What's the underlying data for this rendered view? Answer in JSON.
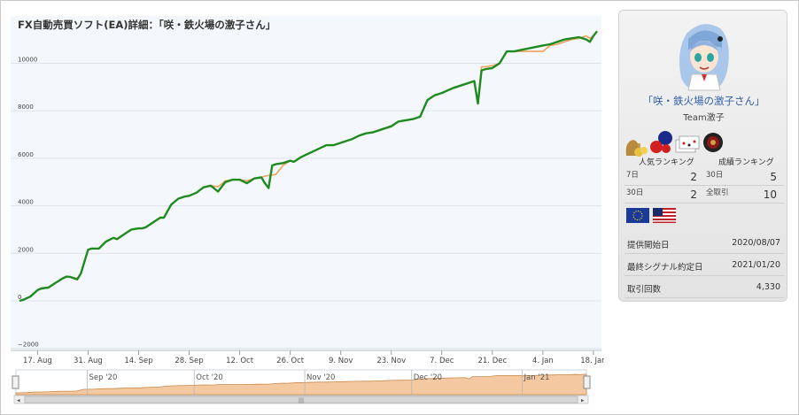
{
  "chart_data": {
    "type": "line",
    "title": "FX自動売買ソフト(EA)詳細：「咲・鉄火場の激子さん」",
    "xlabel": "",
    "ylabel": "",
    "ylim": [
      -2000,
      11800
    ],
    "yticks": [
      -2000,
      0,
      2000,
      4000,
      6000,
      8000,
      10000
    ],
    "ytick_labels": [
      "−2000",
      "0",
      "2000",
      "4000",
      "6000",
      "8000",
      "10000"
    ],
    "x_start": "2020-08-12",
    "x_end": "2021-01-19",
    "xticks": [
      "2020-08-17",
      "2020-08-31",
      "2020-09-14",
      "2020-09-28",
      "2020-10-12",
      "2020-10-26",
      "2020-11-09",
      "2020-11-23",
      "2020-12-07",
      "2020-12-21",
      "2021-01-04",
      "2021-01-18"
    ],
    "xtick_labels": [
      "17. Aug",
      "31. Aug",
      "14. Sep",
      "28. Sep",
      "12. Oct",
      "26. Oct",
      "9. Nov",
      "23. Nov",
      "7. Dec",
      "21. Dec",
      "4. Jan",
      "18. Jan"
    ],
    "grid": true,
    "series": [
      {
        "color": "#f0a060",
        "x": [
          "2020-08-12",
          "2020-08-13",
          "2020-08-15",
          "2020-08-17",
          "2020-08-18",
          "2020-08-20",
          "2020-08-22",
          "2020-08-24",
          "2020-08-25",
          "2020-08-26",
          "2020-08-28",
          "2020-08-29",
          "2020-08-31",
          "2020-09-01",
          "2020-09-03",
          "2020-09-05",
          "2020-09-07",
          "2020-09-08",
          "2020-09-10",
          "2020-09-12",
          "2020-09-14",
          "2020-09-15",
          "2020-09-16",
          "2020-09-18",
          "2020-09-20",
          "2020-09-21",
          "2020-09-23",
          "2020-09-25",
          "2020-09-27",
          "2020-09-28",
          "2020-09-30",
          "2020-10-02",
          "2020-10-04",
          "2020-10-06",
          "2020-10-08",
          "2020-10-10",
          "2020-10-12",
          "2020-10-14",
          "2020-10-16",
          "2020-10-18",
          "2020-10-19",
          "2020-10-21",
          "2020-10-22",
          "2020-10-24",
          "2020-10-26",
          "2020-10-27",
          "2020-10-29",
          "2020-11-05",
          "2020-11-07",
          "2020-11-09",
          "2020-11-12",
          "2020-11-14",
          "2020-11-16",
          "2020-11-18",
          "2020-11-20",
          "2020-11-23",
          "2020-11-25",
          "2020-11-27",
          "2020-11-29",
          "2020-12-01",
          "2020-12-03",
          "2020-12-05",
          "2020-12-07",
          "2020-12-10",
          "2020-12-14",
          "2020-12-16",
          "2020-12-17",
          "2020-12-18",
          "2020-12-19",
          "2020-12-21",
          "2020-12-23",
          "2020-12-25",
          "2020-12-27",
          "2021-01-04",
          "2021-01-06",
          "2021-01-08",
          "2021-01-10",
          "2021-01-12",
          "2021-01-14",
          "2021-01-16",
          "2021-01-17",
          "2021-01-18",
          "2021-01-19"
        ],
        "y": [
          0,
          40,
          180,
          450,
          520,
          560,
          760,
          950,
          1020,
          1010,
          950,
          1150,
          2150,
          2200,
          2200,
          2500,
          2650,
          2580,
          2800,
          3000,
          3050,
          3050,
          3100,
          3300,
          3500,
          3500,
          4050,
          4300,
          4400,
          4420,
          4550,
          4780,
          4850,
          4800,
          5050,
          5100,
          5100,
          5050,
          5150,
          5200,
          5250,
          5300,
          5320,
          5700,
          5900,
          5850,
          6050,
          6550,
          6550,
          6650,
          6800,
          6950,
          7050,
          7100,
          7200,
          7350,
          7550,
          7600,
          7650,
          7750,
          8450,
          8650,
          8750,
          8950,
          9150,
          9250,
          8400,
          9850,
          9850,
          9900,
          10000,
          10500,
          10500,
          10500,
          10750,
          10800,
          10900,
          11000,
          11050,
          11150,
          11050,
          11150,
          11350
        ]
      },
      {
        "color": "#1f8a1f",
        "x": [
          "2020-08-12",
          "2020-08-13",
          "2020-08-15",
          "2020-08-17",
          "2020-08-18",
          "2020-08-20",
          "2020-08-22",
          "2020-08-24",
          "2020-08-25",
          "2020-08-26",
          "2020-08-28",
          "2020-08-29",
          "2020-08-31",
          "2020-09-01",
          "2020-09-03",
          "2020-09-05",
          "2020-09-07",
          "2020-09-08",
          "2020-09-10",
          "2020-09-12",
          "2020-09-14",
          "2020-09-15",
          "2020-09-16",
          "2020-09-18",
          "2020-09-20",
          "2020-09-21",
          "2020-09-23",
          "2020-09-25",
          "2020-09-27",
          "2020-09-28",
          "2020-09-30",
          "2020-10-02",
          "2020-10-04",
          "2020-10-06",
          "2020-10-08",
          "2020-10-10",
          "2020-10-12",
          "2020-10-14",
          "2020-10-16",
          "2020-10-18",
          "2020-10-19",
          "2020-10-20",
          "2020-10-21",
          "2020-10-22",
          "2020-10-24",
          "2020-10-26",
          "2020-10-27",
          "2020-10-29",
          "2020-11-05",
          "2020-11-07",
          "2020-11-09",
          "2020-11-12",
          "2020-11-14",
          "2020-11-16",
          "2020-11-18",
          "2020-11-20",
          "2020-11-23",
          "2020-11-25",
          "2020-11-27",
          "2020-11-29",
          "2020-12-01",
          "2020-12-03",
          "2020-12-05",
          "2020-12-07",
          "2020-12-10",
          "2020-12-14",
          "2020-12-16",
          "2020-12-17",
          "2020-12-18",
          "2020-12-19",
          "2020-12-21",
          "2020-12-23",
          "2020-12-25",
          "2020-12-27",
          "2021-01-04",
          "2021-01-06",
          "2021-01-08",
          "2021-01-10",
          "2021-01-12",
          "2021-01-14",
          "2021-01-16",
          "2021-01-17",
          "2021-01-18",
          "2021-01-19"
        ],
        "y": [
          0,
          40,
          180,
          450,
          520,
          560,
          760,
          950,
          1020,
          1010,
          900,
          1150,
          2150,
          2200,
          2200,
          2500,
          2650,
          2600,
          2800,
          3000,
          3050,
          3050,
          3100,
          3300,
          3500,
          3500,
          4050,
          4300,
          4400,
          4420,
          4550,
          4780,
          4850,
          4600,
          5000,
          5100,
          5100,
          4950,
          5150,
          5200,
          4950,
          4750,
          5700,
          5750,
          5800,
          5900,
          5850,
          6050,
          6550,
          6550,
          6650,
          6800,
          6950,
          7050,
          7100,
          7200,
          7350,
          7550,
          7600,
          7650,
          7750,
          8450,
          8650,
          8750,
          8950,
          9150,
          9250,
          8300,
          9700,
          9750,
          9800,
          10000,
          10500,
          10500,
          10750,
          10800,
          10900,
          11000,
          11050,
          11100,
          11000,
          10900,
          11150,
          11350
        ]
      }
    ],
    "navigator": {
      "month_labels": [
        "Sep '20",
        "Oct '20",
        "Nov '20",
        "Dec '20",
        "Jan '21"
      ],
      "month_dates": [
        "2020-09-01",
        "2020-10-01",
        "2020-11-01",
        "2020-12-01",
        "2021-01-01"
      ],
      "fill_color": "#f4c8a0",
      "scroll_grip": "|||"
    }
  },
  "colors": {
    "plot_bg": "#f4f8fc",
    "grid": "#dde3ea",
    "orange": "#f0a060",
    "green": "#1f8a1f",
    "link": "#2f5fa8"
  },
  "profile": {
    "avatar_icon": "anime-girl-avatar-icon",
    "name": "「咲・鉄火場の激子さん」",
    "team": "Team激子",
    "badge_icons": [
      "money-bag-icon",
      "speech-bubbles-icon",
      "cards-icon",
      "roulette-icon"
    ],
    "ranking_popular": "人気ランキング",
    "ranking_performance": "成績ランキング",
    "stats": [
      [
        {
          "label": "7日",
          "value": "2"
        },
        {
          "label": "30日",
          "value": "5"
        }
      ],
      [
        {
          "label": "30日",
          "value": "2"
        },
        {
          "label": "全取引",
          "value": "10"
        }
      ]
    ],
    "currency_flags": [
      "eu-flag-icon",
      "us-flag-icon"
    ],
    "info": [
      {
        "label": "提供開始日",
        "value": "2020/08/07"
      },
      {
        "label": "最終シグナル約定日",
        "value": "2021/01/20"
      },
      {
        "label": "取引回数",
        "value": "4,330"
      }
    ]
  }
}
